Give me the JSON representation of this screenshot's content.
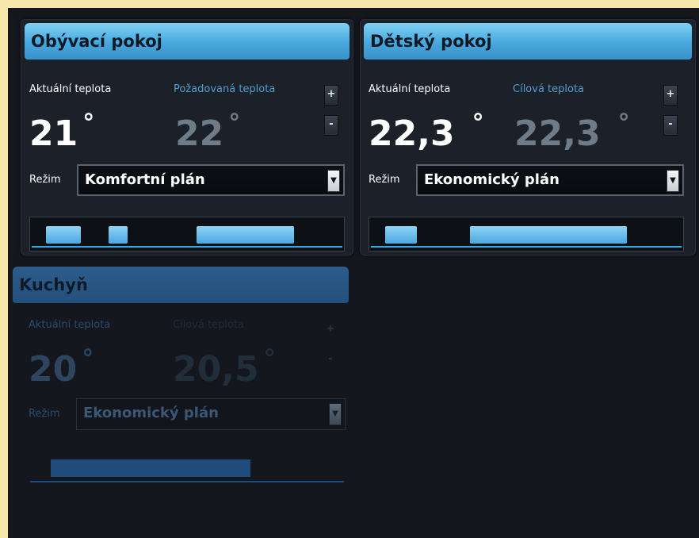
{
  "rooms": [
    {
      "name": "Obývací pokoj",
      "current_label": "Aktuální teplota",
      "current_value": "21",
      "target_label": "Požadovaná teplota",
      "target_value": "22",
      "degree": "°",
      "plus": "+",
      "minus": "-",
      "mode_label": "Režim",
      "mode_value": "Komfortní plán",
      "schedule": [
        [
          0.05,
          0.16
        ],
        [
          0.25,
          0.31
        ],
        [
          0.53,
          0.84
        ]
      ]
    },
    {
      "name": "Dětský pokoj",
      "current_label": "Aktuální teplota",
      "current_value": "22,3",
      "target_label": "Cílová teplota",
      "target_value": "22,3",
      "degree": "°",
      "plus": "+",
      "minus": "-",
      "mode_label": "Režim",
      "mode_value": "Ekonomický plán",
      "schedule": [
        [
          0.05,
          0.15
        ],
        [
          0.32,
          0.82
        ]
      ]
    },
    {
      "name": "Kuchyň",
      "current_label": "Aktuální teplota",
      "current_value": "20",
      "target_label": "Cílová teplota",
      "target_value": "20,5",
      "degree": "°",
      "plus": "+",
      "minus": "-",
      "mode_label": "Režim",
      "mode_value": "Ekonomický plán",
      "schedule": [
        [
          0.07,
          0.7
        ]
      ]
    }
  ],
  "colors": {
    "header_blue": "#46a8de",
    "segment_blue": "#4aa8e0",
    "target_gray": "#6e7c89",
    "background": "#14171d",
    "frame": "#f6e6a8"
  }
}
